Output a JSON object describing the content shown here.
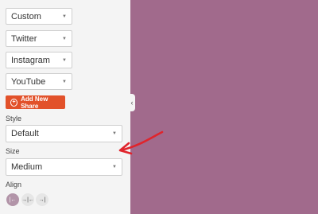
{
  "networks": [
    {
      "label": "Custom"
    },
    {
      "label": "Twitter"
    },
    {
      "label": "Instagram"
    },
    {
      "label": "YouTube"
    }
  ],
  "add_button": {
    "label": "Add New Share"
  },
  "style": {
    "label": "Style",
    "value": "Default"
  },
  "size": {
    "label": "Size",
    "value": "Medium"
  },
  "align": {
    "label": "Align",
    "options": [
      "left",
      "center",
      "right"
    ],
    "selected": "left"
  },
  "colors": {
    "canvas": "#a16a8c",
    "accent": "#e2512a",
    "annotation_arrow": "#e0242c"
  }
}
